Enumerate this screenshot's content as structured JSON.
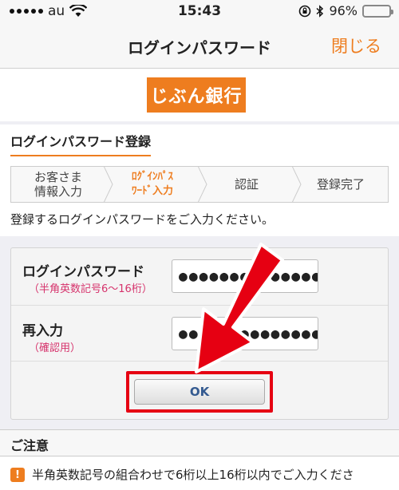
{
  "status_bar": {
    "carrier": "au",
    "time": "15:43",
    "battery_percent": "96%",
    "battery_level": 0.96
  },
  "nav": {
    "title": "ログインパスワード",
    "close_label": "閉じる"
  },
  "logo": {
    "text": "じぶん銀行",
    "color": "#ee7d1f"
  },
  "section": {
    "title": "ログインパスワード登録"
  },
  "steps": [
    {
      "line1": "お客さま",
      "line2": "情報入力",
      "active": false
    },
    {
      "line1": "ﾛｸﾞｲﾝﾊﾟｽ",
      "line2": "ﾜｰﾄﾞ入力",
      "active": true
    },
    {
      "line1": "認証",
      "line2": "",
      "active": false
    },
    {
      "line1": "登録完了",
      "line2": "",
      "active": false
    }
  ],
  "instruction": "登録するログインパスワードをご入力ください。",
  "form": {
    "password": {
      "label": "ログインパスワード",
      "sublabel": "（半角英数記号6〜16桁）",
      "value": "●●●●●●●●●●●●●●"
    },
    "confirm": {
      "label": "再入力",
      "sublabel": "（確認用）",
      "value": "●●●●●●●●●●●●●●"
    },
    "ok_label": "OK"
  },
  "caution": {
    "title": "ご注意",
    "icon": "!",
    "text": "半角英数記号の組合わせで6桁以上16桁以内でご入力くださ"
  },
  "colors": {
    "accent": "#ee7d1f",
    "highlight": "#e60012",
    "sublabel": "#d6336c"
  }
}
